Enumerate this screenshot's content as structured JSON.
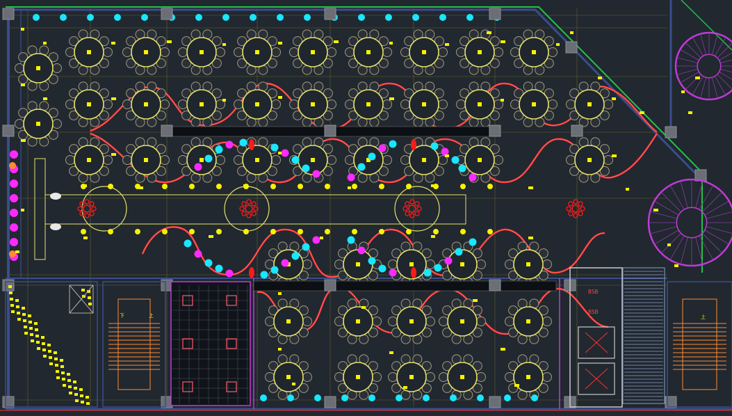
{
  "drawing": {
    "type": "CAD floor plan (banquet hall, top view)",
    "colors": {
      "background": "#212830",
      "wall": "#3a4d8c",
      "column": "#6b6f75",
      "table": "#e6e36a",
      "chair": "#a49a7a",
      "garland": "#ff2a4a",
      "garland_inner": "#ff8a3a",
      "light_cyan": "#19e6ff",
      "light_magenta": "#ff2aff",
      "light_yellow": "#f7f200",
      "red_fixture": "#ff1a1a",
      "grid": "#8a7a2a",
      "green_edge": "#23c24a",
      "stair_orange": "#ff8a30",
      "stair_magenta": "#c23ad9",
      "elevator": "#c9c9c9"
    },
    "labels": {
      "lower_room_1": "上",
      "lower_room_2": "上",
      "lower_room_3": "下",
      "lift_1": "BSB",
      "lift_2": "BSB"
    }
  }
}
